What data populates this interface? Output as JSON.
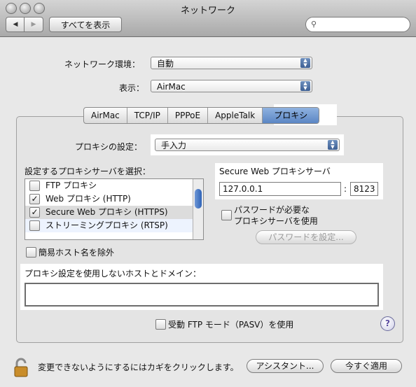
{
  "window": {
    "title": "ネットワーク"
  },
  "toolbar": {
    "back_icon": "◀",
    "forward_icon": "▶",
    "show_all_label": "すべてを表示",
    "search_placeholder": ""
  },
  "location": {
    "label": "ネットワーク環境：",
    "value": "自動"
  },
  "show": {
    "label": "表示：",
    "value": "AirMac"
  },
  "tabs": [
    {
      "label": "AirMac"
    },
    {
      "label": "TCP/IP"
    },
    {
      "label": "PPPoE"
    },
    {
      "label": "AppleTalk"
    },
    {
      "label": "プロキシ",
      "selected": true
    }
  ],
  "proxy_config": {
    "label": "プロキシの設定：",
    "value": "手入力"
  },
  "proxy_list": {
    "label": "設定するプロキシサーバを選択：",
    "items": [
      {
        "label": "FTP プロキシ",
        "checked": false
      },
      {
        "label": "Web プロキシ (HTTP)",
        "checked": true
      },
      {
        "label": "Secure Web プロキシ (HTTPS)",
        "checked": true
      },
      {
        "label": "ストリーミングプロキシ (RTSP)",
        "checked": false
      }
    ]
  },
  "server": {
    "title": "Secure Web プロキシサーバ",
    "host": "127.0.0.1",
    "separator": ":",
    "port": "8123"
  },
  "password": {
    "label_line1": "パスワードが必要な",
    "label_line2": "プロキシサーバを使用",
    "set_button": "パスワードを設定..."
  },
  "exclude_simple": {
    "label": "簡易ホスト名を除外"
  },
  "bypass": {
    "label": "プロキシ設定を使用しないホストとドメイン：",
    "value": ""
  },
  "pasv": {
    "label": "受動 FTP モード（PASV）を使用"
  },
  "help": {
    "label": "?"
  },
  "footer": {
    "lock_text": "変更できないようにするにはカギをクリックします。",
    "assist_button": "アシスタント...",
    "apply_button": "今すぐ適用"
  },
  "colors": {
    "selected_tab": "#5b86c4",
    "highlight": "#ffffff"
  }
}
